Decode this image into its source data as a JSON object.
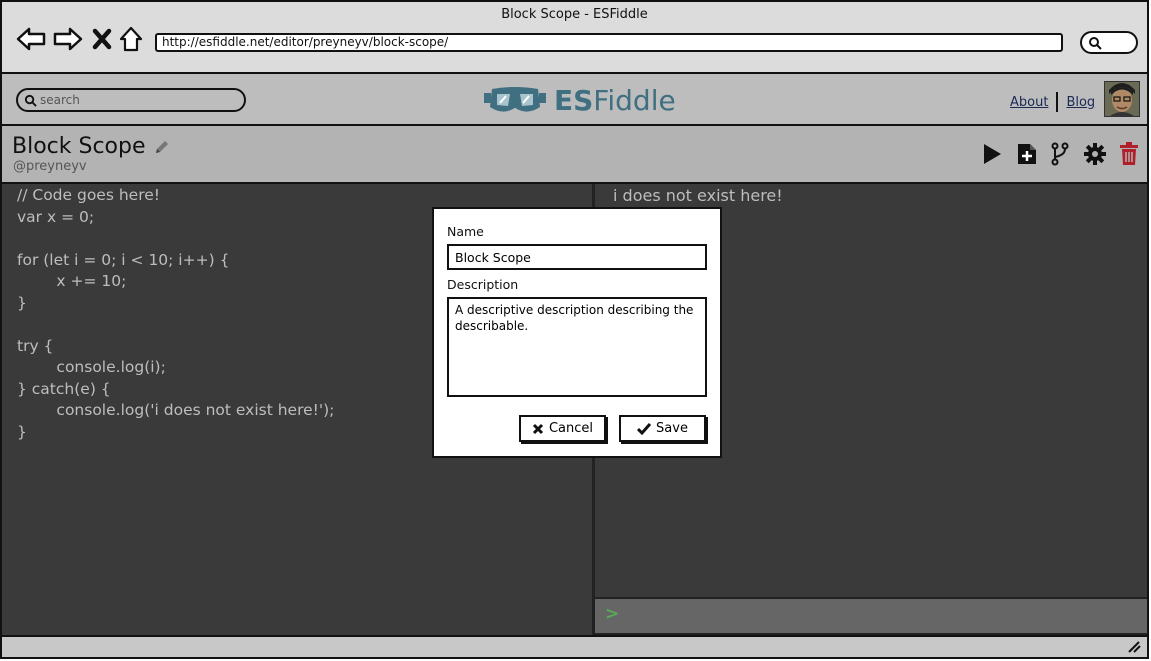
{
  "browser": {
    "title": "Block Scope - ESFiddle",
    "url": "http://esfiddle.net/editor/preyneyv/block-scope/",
    "nav_icons": [
      "back-arrow-icon",
      "forward-arrow-icon",
      "stop-icon",
      "home-icon"
    ]
  },
  "header": {
    "search_placeholder": "search",
    "logo_bold": "ES",
    "logo_rest": "Fiddle",
    "links": {
      "about": "About",
      "blog": "Blog"
    }
  },
  "fiddle": {
    "title": "Block Scope",
    "user": "@preyneyv",
    "toolbar_icons": [
      "play-icon",
      "new-file-icon",
      "fork-icon",
      "gear-icon",
      "trash-icon"
    ]
  },
  "editor": {
    "code": "// Code goes here!\nvar x = 0;\n\nfor (let i = 0; i < 10; i++) {\n        x += 10;\n}\n\ntry {\n        console.log(i);\n} catch(e) {\n        console.log('i does not exist here!');\n}"
  },
  "output": {
    "line": "i does not exist here!",
    "prompt": ">"
  },
  "dialog": {
    "name_label": "Name",
    "name_value": "Block Scope",
    "description_label": "Description",
    "description_value": "A descriptive description describing the describable.",
    "cancel_label": "Cancel",
    "save_label": "Save"
  },
  "colors": {
    "editor_bg": "#3a3a3a",
    "code_text": "#bdbdbd",
    "logo": "#3f6f80",
    "delete": "#b0202a",
    "prompt": "#5aa85a"
  }
}
